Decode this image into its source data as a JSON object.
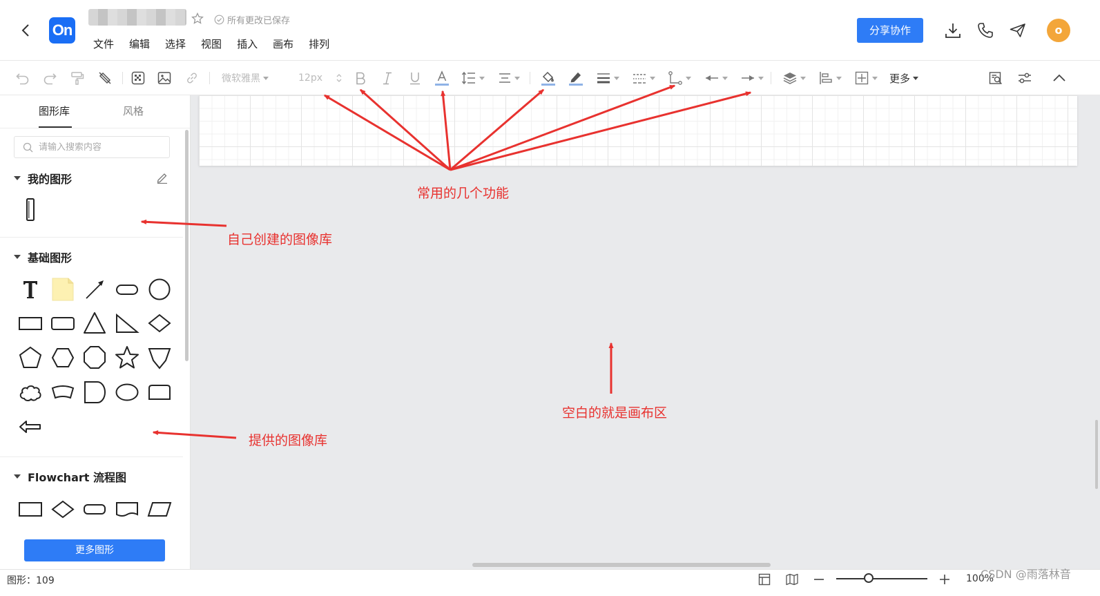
{
  "header": {
    "logo_text": "On",
    "save_status": "所有更改已保存",
    "menu": [
      "文件",
      "编辑",
      "选择",
      "视图",
      "插入",
      "画布",
      "排列"
    ],
    "share_label": "分享协作",
    "avatar_letter": "o",
    "logo_color": "#1a6ef5",
    "accent_color": "#2e7cf6",
    "avatar_color": "#f3a63a"
  },
  "toolbar": {
    "font_family": "微软雅黑",
    "font_size": "12px",
    "more_label": "更多",
    "icons": [
      "undo-icon",
      "redo-icon",
      "format-painter-icon",
      "clear-format-icon",
      "fill-pattern-icon",
      "image-icon",
      "link-icon",
      "bold-icon",
      "italic-icon",
      "underline-icon",
      "font-color-icon",
      "line-height-icon",
      "align-icon",
      "fill-color-icon",
      "line-color-icon",
      "line-width-icon",
      "line-style-icon",
      "connector-icon",
      "arrow-start-icon",
      "arrow-end-icon",
      "layers-icon",
      "align-objects-icon",
      "position-icon",
      "find-icon",
      "settings-icon",
      "collapse-icon"
    ]
  },
  "sidebar": {
    "tabs": [
      "图形库",
      "风格"
    ],
    "search_placeholder": "请输入搜索内容",
    "sections": [
      {
        "title": "我的图形"
      },
      {
        "title": "基础图形"
      },
      {
        "title": "Flowchart 流程图"
      }
    ],
    "more_shapes_label": "更多图形"
  },
  "annotations": {
    "toolbar_note": "常用的几个功能",
    "my_library_note": "自己创建的图像库",
    "provided_library_note": "提供的图像库",
    "canvas_note": "空白的就是画布区",
    "color": "#e8322f"
  },
  "status": {
    "shape_count": "图形：109",
    "zoom": "100%",
    "watermark": "CSDN @雨落林音"
  }
}
